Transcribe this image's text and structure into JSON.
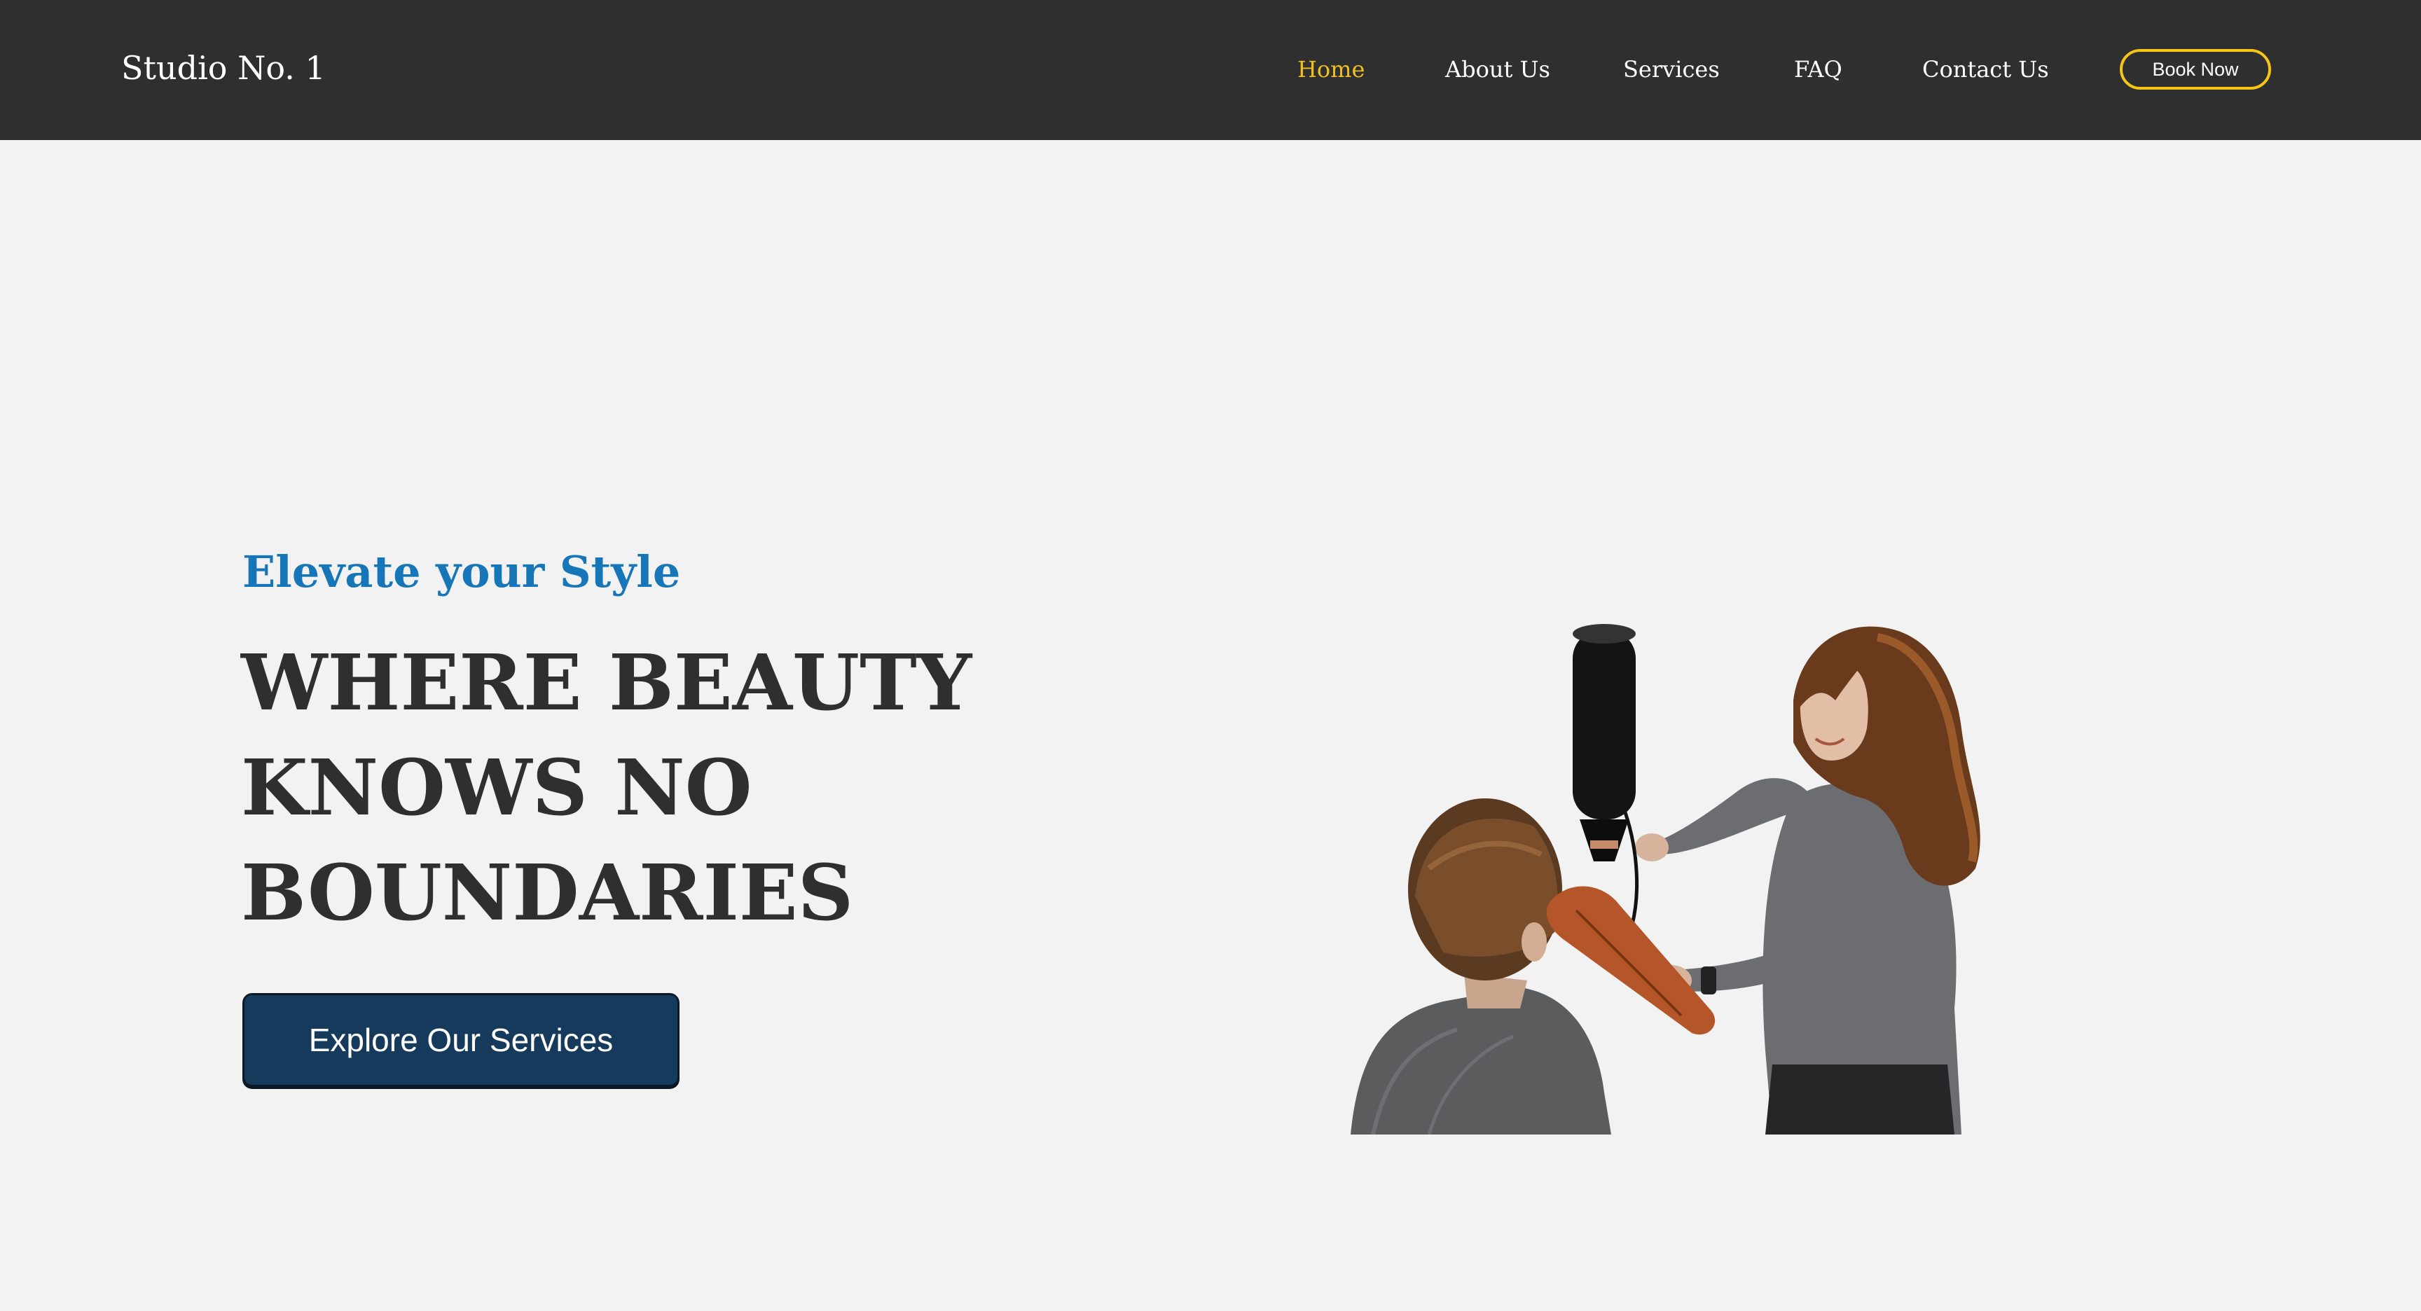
{
  "nav": {
    "brand": "Studio No. 1",
    "links": [
      "Home",
      "About Us",
      "Services",
      "FAQ",
      "Contact Us"
    ],
    "active_index": 0,
    "book_label": "Book Now"
  },
  "hero": {
    "subtitle": "Elevate your Style",
    "title_lines": [
      "WHERE BEAUTY",
      "KNOWS NO",
      "BOUNDARIES"
    ],
    "cta_label": "Explore Our Services"
  },
  "colors": {
    "nav_bg": "#2f2f2f",
    "active_link": "#f0c020",
    "button_border": "#f5c518",
    "subtitle": "#1676b8",
    "cta_bg": "#163a5c",
    "page_bg": "#f2f2f2"
  },
  "icons": {
    "hero_image": "stylist-blow-drying-client-photo"
  }
}
